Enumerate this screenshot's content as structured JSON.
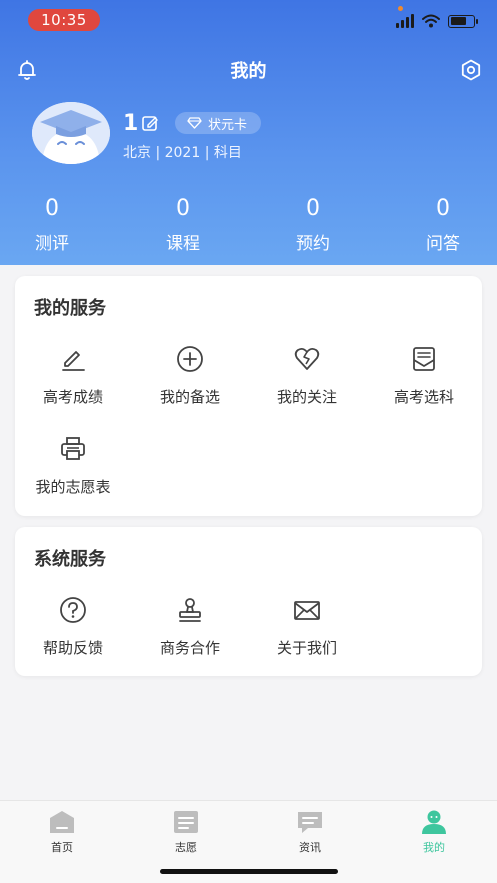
{
  "status_bar": {
    "time": "10:35"
  },
  "header": {
    "title": "我的",
    "username": "1",
    "vip_label": "状元卡",
    "meta": "北京 | 2021 | 科目"
  },
  "stats": [
    {
      "value": "0",
      "label": "测评"
    },
    {
      "value": "0",
      "label": "课程"
    },
    {
      "value": "0",
      "label": "预约"
    },
    {
      "value": "0",
      "label": "问答"
    }
  ],
  "my_services": {
    "title": "我的服务",
    "items": [
      {
        "label": "高考成绩",
        "icon": "pen-underline-icon"
      },
      {
        "label": "我的备选",
        "icon": "plus-circle-icon"
      },
      {
        "label": "我的关注",
        "icon": "heart-icon"
      },
      {
        "label": "高考选科",
        "icon": "envelope-open-icon"
      },
      {
        "label": "我的志愿表",
        "icon": "printer-icon"
      }
    ]
  },
  "system_services": {
    "title": "系统服务",
    "items": [
      {
        "label": "帮助反馈",
        "icon": "question-circle-icon"
      },
      {
        "label": "商务合作",
        "icon": "stamp-icon"
      },
      {
        "label": "关于我们",
        "icon": "mail-icon"
      }
    ]
  },
  "tabbar": [
    {
      "label": "首页",
      "icon": "home-icon"
    },
    {
      "label": "志愿",
      "icon": "document-icon"
    },
    {
      "label": "资讯",
      "icon": "chat-icon"
    },
    {
      "label": "我的",
      "icon": "user-icon",
      "active": true
    }
  ],
  "colors": {
    "header_top": "#3f75e4",
    "header_bottom": "#6aa7f2",
    "active_tab": "#3ec69e",
    "time_pill": "#e0473e"
  }
}
